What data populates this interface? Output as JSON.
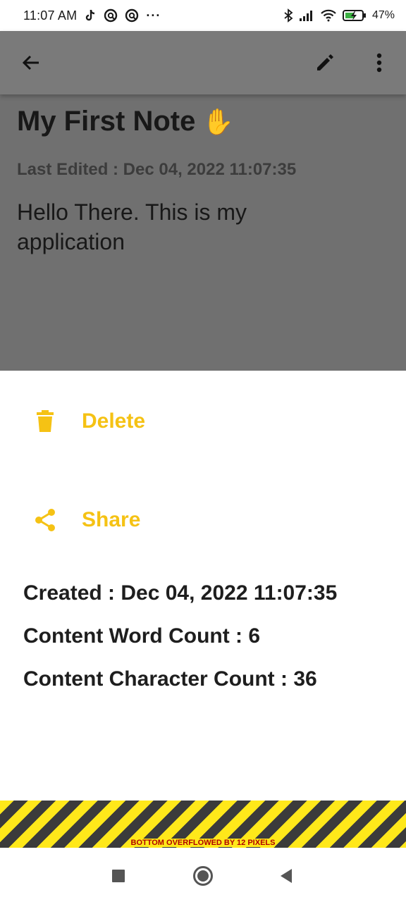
{
  "status_bar": {
    "time": "11:07 AM",
    "more_indicator": "···",
    "battery_percent": "47%",
    "icons": [
      "tiktok-icon",
      "notification-icon",
      "notification-icon",
      "bluetooth-icon",
      "signal-icon",
      "wifi-icon",
      "battery-charging-icon"
    ]
  },
  "app_bar": {
    "back_icon": "arrow-back-icon",
    "edit_icon": "pencil-icon",
    "menu_icon": "more-vert-icon"
  },
  "note": {
    "title": "My First Note",
    "title_emoji": "✋",
    "last_edited": "Last Edited : Dec 04, 2022  11:07:35",
    "content": "Hello There. This is my application"
  },
  "sheet": {
    "accent_color": "#f5c214",
    "delete_label": "Delete",
    "share_label": "Share",
    "created": "Created :  Dec 04, 2022 11:07:35",
    "word_count": "Content Word Count :  6",
    "char_count": "Content Character Count :  36"
  },
  "overflow": {
    "message": "BOTTOM OVERFLOWED BY 12 PIXELS"
  },
  "nav_bar": {
    "icons": [
      "recents-square-icon",
      "home-circle-icon",
      "back-triangle-icon"
    ]
  }
}
